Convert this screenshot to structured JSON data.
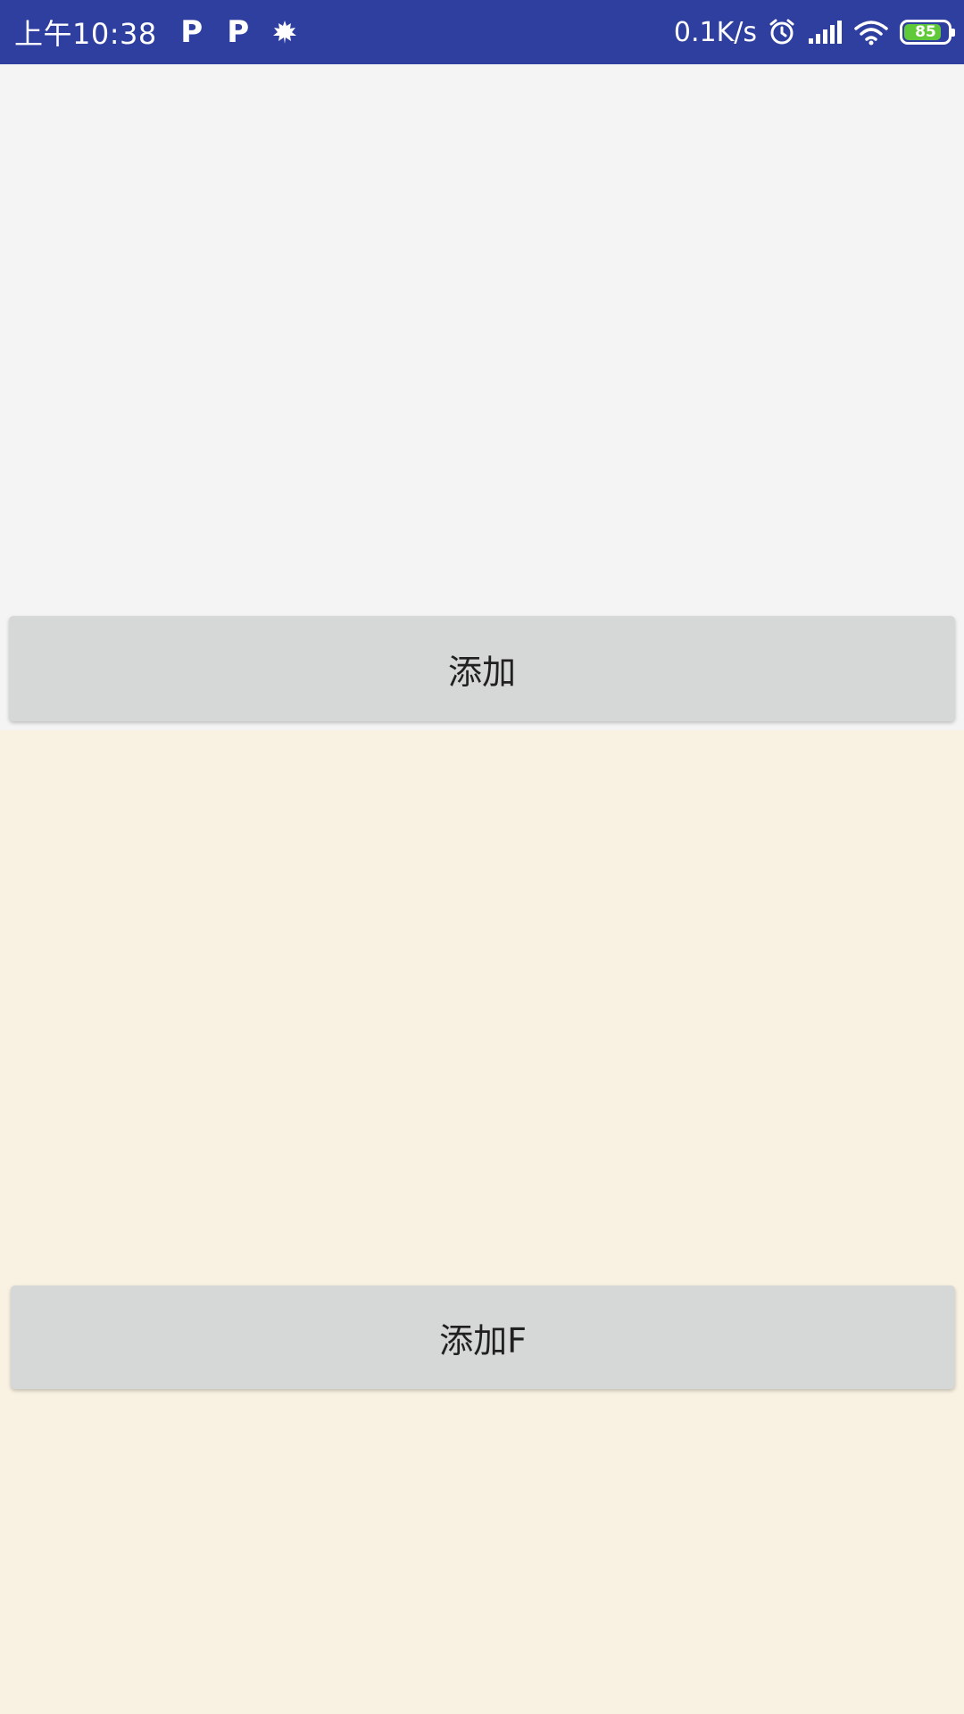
{
  "colors": {
    "status_bar": "#2f3f9f",
    "top_panel_bg": "#f4f4f4",
    "bottom_panel_bg": "#f9f2e2",
    "button_bg": "#d6d7d7",
    "battery_fill": "#5fc93a"
  },
  "status_bar": {
    "time": "上午10:38",
    "notification_icons": [
      "p-icon",
      "p-icon",
      "leaf-icon"
    ],
    "p_glyph": "P",
    "network_speed": "0.1K/s",
    "icons": [
      "alarm-icon",
      "signal-icon",
      "wifi-icon",
      "battery-icon"
    ],
    "battery_level": "85",
    "battery_fraction": 0.85
  },
  "top_panel": {
    "add_button_label": "添加"
  },
  "bottom_panel": {
    "add_f_button_label": "添加F"
  }
}
